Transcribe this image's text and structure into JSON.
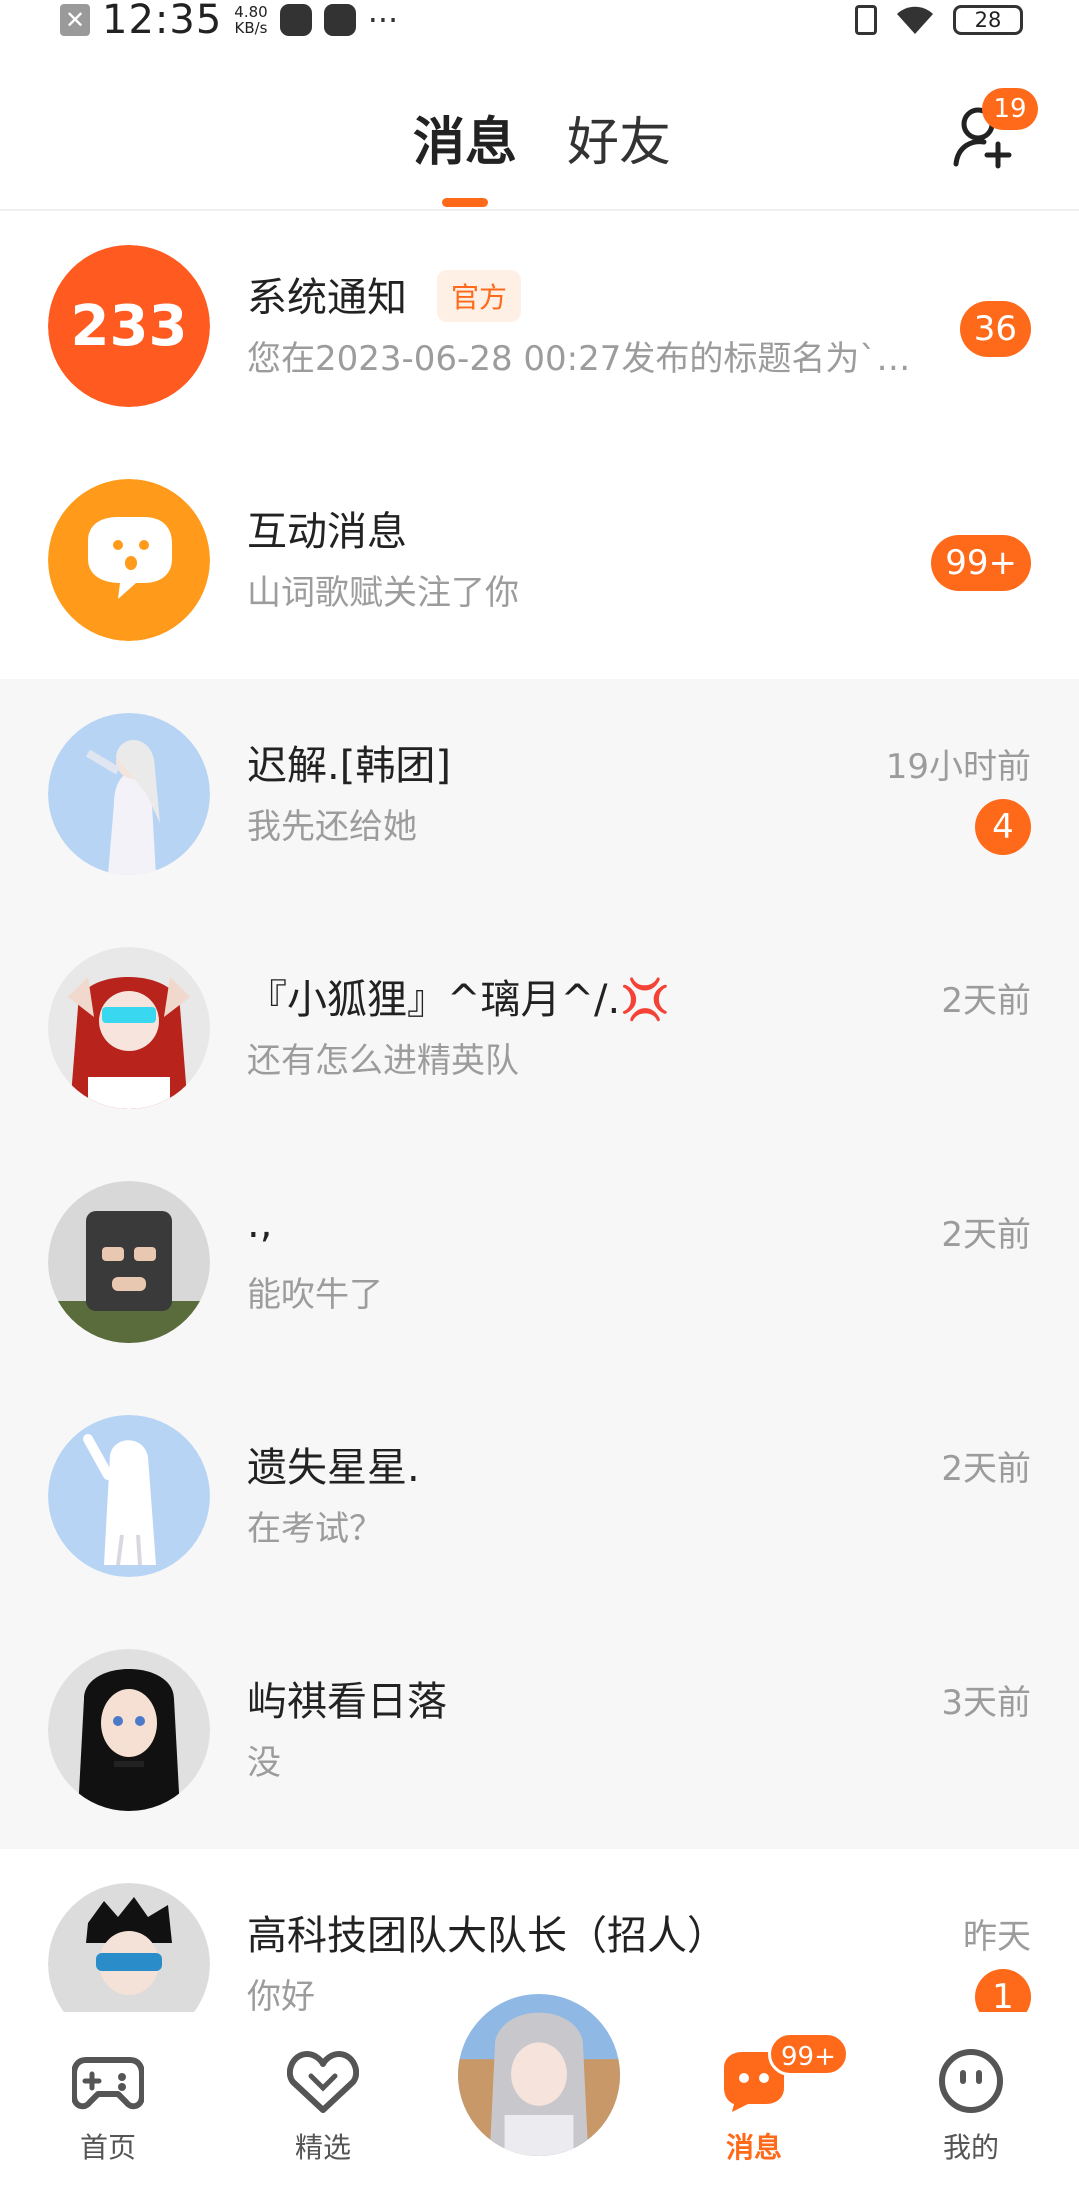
{
  "status_bar": {
    "time": "12:35",
    "net_speed_value": "4.80",
    "net_speed_unit": "KB/s",
    "battery": "28"
  },
  "header": {
    "tabs": [
      {
        "label": "消息",
        "active": true
      },
      {
        "label": "好友",
        "active": false
      }
    ],
    "add_friend_badge": "19"
  },
  "conversations": [
    {
      "title": "系统通知",
      "tag": "官方",
      "preview": "您在2023-06-28 00:27发布的标题名为`…",
      "time": "",
      "badge": "36",
      "avatar_icon": "app-logo-233-icon"
    },
    {
      "title": "互动消息",
      "tag": "",
      "preview": "山词歌赋关注了你",
      "time": "",
      "badge": "99+",
      "avatar_icon": "chat-bubble-smile-icon"
    },
    {
      "title": "迟解.[韩团]",
      "tag": "",
      "preview": "我先还给她",
      "time": "19小时前",
      "badge": "4",
      "avatar_icon": "avatar"
    },
    {
      "title": "『小狐狸』^璃月^/.💢",
      "tag": "",
      "preview": "还有怎么进精英队",
      "time": "2天前",
      "badge": "",
      "avatar_icon": "avatar"
    },
    {
      "title": ".,",
      "tag": "",
      "preview": "能吹牛了",
      "time": "2天前",
      "badge": "",
      "avatar_icon": "avatar"
    },
    {
      "title": "遗失星星.",
      "tag": "",
      "preview": "在考试？",
      "time": "2天前",
      "badge": "",
      "avatar_icon": "avatar"
    },
    {
      "title": "屿祺看日落",
      "tag": "",
      "preview": "没",
      "time": "3天前",
      "badge": "",
      "avatar_icon": "avatar"
    },
    {
      "title": "高科技团队大队长（招人）",
      "tag": "",
      "preview": "你好",
      "time": "昨天",
      "badge": "1",
      "avatar_icon": "avatar"
    }
  ],
  "bottom_nav": {
    "items": [
      {
        "label": "首页",
        "icon": "gamepad-icon",
        "active": false
      },
      {
        "label": "精选",
        "icon": "heart-badge-icon",
        "active": false
      },
      {
        "label": "消息",
        "icon": "chat-icon",
        "active": true,
        "badge": "99+"
      },
      {
        "label": "我的",
        "icon": "face-icon",
        "active": false
      }
    ]
  },
  "colors": {
    "accent": "#ff6a1a",
    "row_grey": "#f7f7f7",
    "text_primary": "#222222",
    "text_secondary": "#9c9c9c"
  }
}
